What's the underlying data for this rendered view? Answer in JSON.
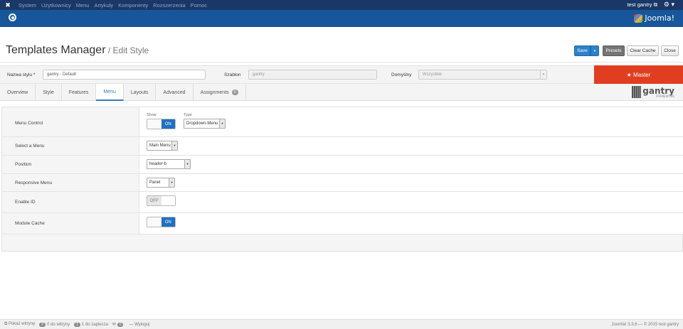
{
  "topbar": {
    "menu": [
      "System",
      "Użytkownicy",
      "Menu",
      "Artykuły",
      "Komponenty",
      "Rozszerzenia",
      "Pomoc"
    ],
    "user": "test gantry ⧉",
    "gear": "⚙ ▾"
  },
  "header": {
    "brand": "Joomla!"
  },
  "title": {
    "main": "Templates Manager",
    "sub": " / Edit Style"
  },
  "toolbar": {
    "save": "Save",
    "save_drop": "▾",
    "presets": "Presets",
    "clear_cache": "Clear Cache",
    "close": "Close"
  },
  "style": {
    "name_label": "Nazwa stylu *",
    "name_value": "gantry - Default",
    "template_label": "Szablon",
    "template_value": "gantry",
    "default_label": "Domyślny",
    "default_value": "Wszystkie",
    "master": "★ Master"
  },
  "tabs": [
    "Overview",
    "Style",
    "Features",
    "Menu",
    "Layouts",
    "Advanced",
    "Assignments"
  ],
  "assignments_count": "0",
  "gantry_logo": {
    "word": "gantry",
    "small": "FRAMEWORK"
  },
  "settings": {
    "menu_control": {
      "label": "Menu Control",
      "show_label": "Show",
      "type_label": "Type",
      "toggle_on": "ON",
      "type_value": "Dropdown-Menu"
    },
    "select_menu": {
      "label": "Select a Menu",
      "value": "Main Menu"
    },
    "position": {
      "label": "Position",
      "value": "header-b"
    },
    "responsive": {
      "label": "Responsive Menu",
      "value": "Panel"
    },
    "enable_id": {
      "label": "Enable ID",
      "toggle_off": "OFF"
    },
    "module_cache": {
      "label": "Module Cache",
      "toggle_on": "ON"
    }
  },
  "footer": {
    "show_site": "⧉ Pokaż witrynę",
    "visitors_count": "0",
    "visitors": "0 do witryny",
    "admin_count": "1",
    "admin": "1 do zaplecza",
    "messages_count": "0",
    "logout": "— Wyloguj",
    "version": "Joomla! 3.3.6 — © 2015 test gantry"
  }
}
